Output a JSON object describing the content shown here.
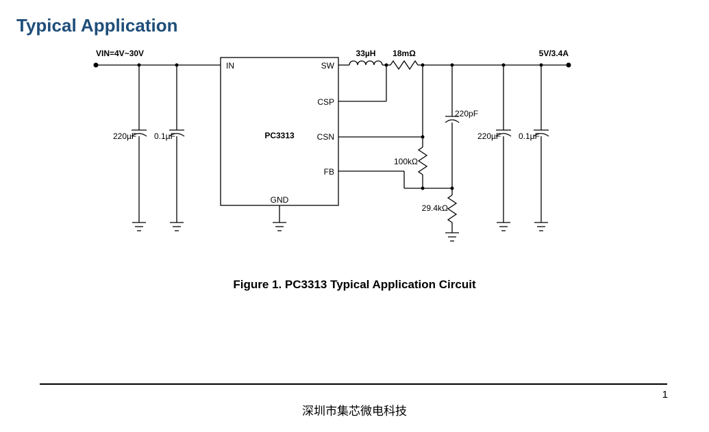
{
  "title": "Typical Application",
  "caption": "Figure 1. PC3313 Typical Application Circuit",
  "footer": "深圳市集芯微电科技",
  "page_number": "1",
  "diagram": {
    "vin_label": "VIN=4V~30V",
    "vout_label": "5V/3.4A",
    "chip_name": "PC3313",
    "pins": {
      "in": "IN",
      "sw": "SW",
      "csp": "CSP",
      "csn": "CSN",
      "fb": "FB",
      "gnd": "GND"
    },
    "components": {
      "cin1": "220µF",
      "cin2": "0.1µF",
      "cout1": "220µF",
      "cout2": "0.1µF",
      "inductor": "33µH",
      "rsense": "18mΩ",
      "r_fb_top": "100kΩ",
      "c_ff": "220pF",
      "r_fb_bot": "29.4kΩ"
    }
  }
}
